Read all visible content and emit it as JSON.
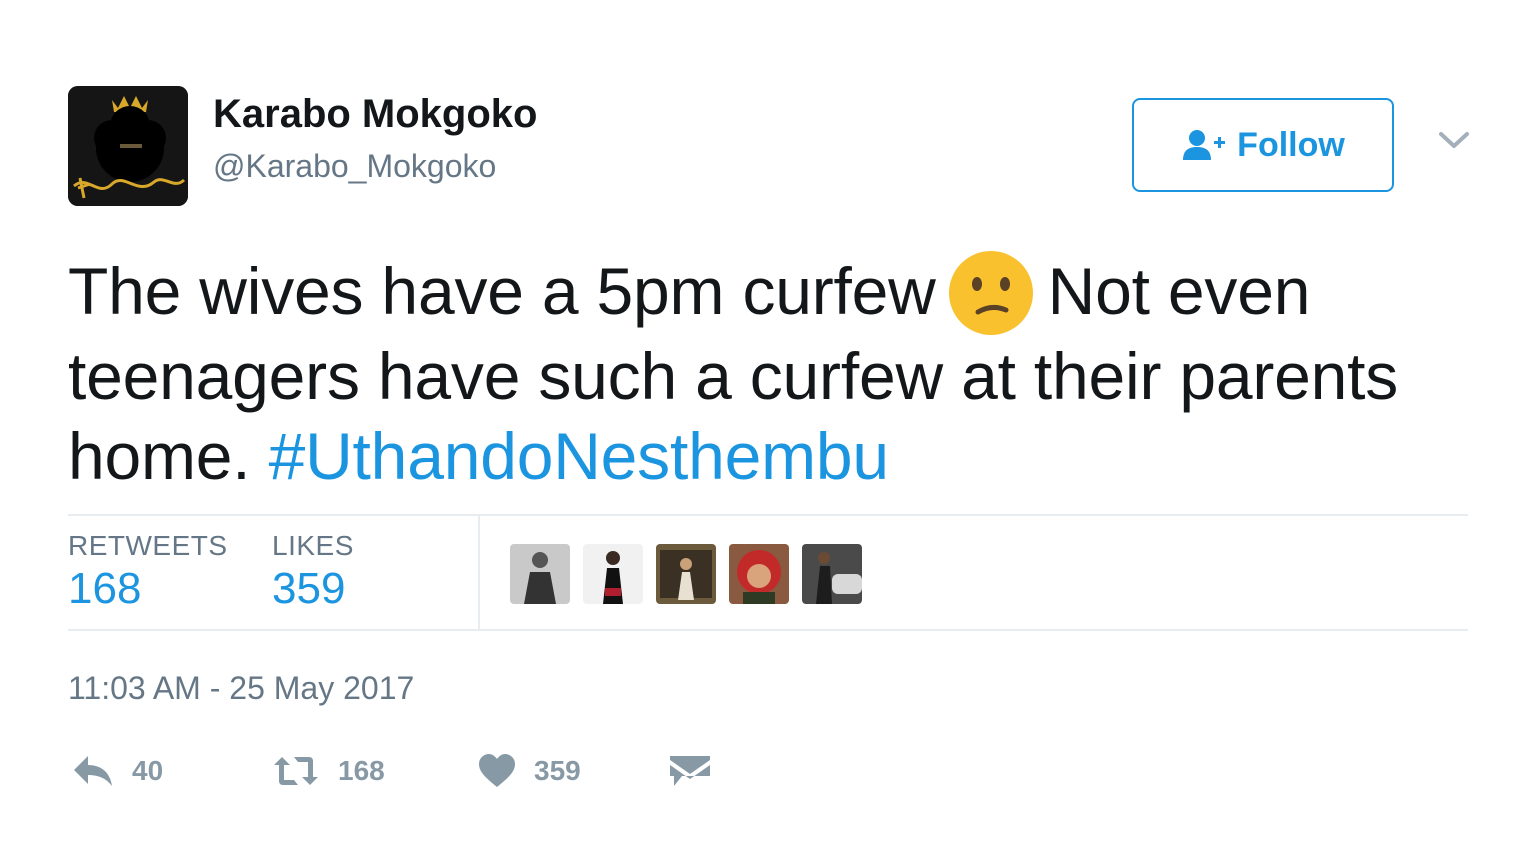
{
  "author": {
    "name": "Karabo Mokgoko",
    "handle": "@Karabo_Mokgoko",
    "avatar_icon": "avatar-karabo-logo"
  },
  "follow_button": {
    "label": "Follow",
    "icon": "add-user-icon",
    "color": "#1b95e0"
  },
  "menu": {
    "icon": "chevron-down-icon"
  },
  "tweet": {
    "text_line1_a": "The wives have a 5pm curfew",
    "emoji": "confused-face-emoji",
    "text_line1_b": "Not even",
    "text_line2": "teenagers have such a curfew at their parents",
    "text_line3": "home.",
    "hashtag": "#UthandoNesthembu"
  },
  "stats": {
    "retweets_label": "RETWEETS",
    "retweets_count": "168",
    "likes_label": "LIKES",
    "likes_count": "359"
  },
  "likers": [
    "liker-1",
    "liker-2",
    "liker-3",
    "liker-4",
    "liker-5"
  ],
  "timestamp": "11:03 AM - 25 May 2017",
  "actions": {
    "reply_count": "40",
    "retweet_count": "168",
    "like_count": "359"
  },
  "colors": {
    "accent": "#1b95e0",
    "muted": "#657786",
    "icon_gray": "#8899a6",
    "emoji_yellow": "#f9c12e"
  }
}
